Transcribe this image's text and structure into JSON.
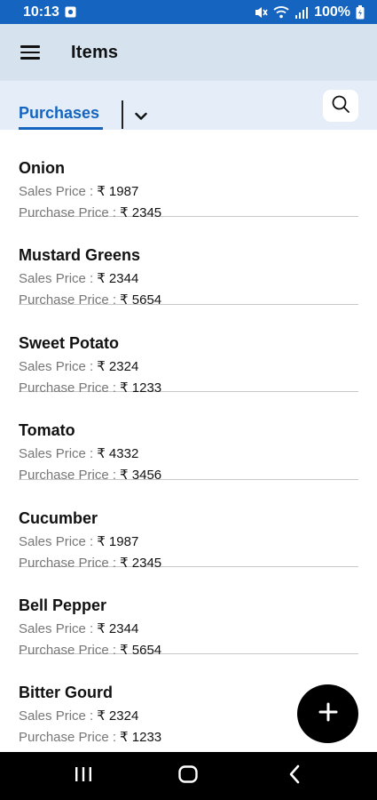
{
  "status_bar": {
    "time": "10:13",
    "battery": "100%"
  },
  "app_bar": {
    "title": "Items"
  },
  "tabs": {
    "active_label": "Purchases"
  },
  "labels": {
    "sales_price": "Sales Price :",
    "purchase_price": "Purchase Price :"
  },
  "items": [
    {
      "name": "Onion",
      "sales_price": "₹ 1987",
      "purchase_price": "₹ 2345"
    },
    {
      "name": "Mustard Greens",
      "sales_price": "₹ 2344",
      "purchase_price": "₹ 5654"
    },
    {
      "name": "Sweet Potato",
      "sales_price": "₹ 2324",
      "purchase_price": "₹ 1233"
    },
    {
      "name": "Tomato",
      "sales_price": "₹ 4332",
      "purchase_price": "₹ 3456"
    },
    {
      "name": "Cucumber",
      "sales_price": "₹ 1987",
      "purchase_price": "₹ 2345"
    },
    {
      "name": "Bell Pepper",
      "sales_price": "₹ 2344",
      "purchase_price": "₹ 5654"
    },
    {
      "name": "Bitter Gourd",
      "sales_price": "₹ 2324",
      "purchase_price": "₹ 1233"
    }
  ],
  "colors": {
    "status_bar": "#1565c0",
    "accent": "#1565c0",
    "app_bar": "#d6e3ef",
    "tab_row": "#e5eef8"
  },
  "icons": {
    "status": [
      "image-notification-icon",
      "mute-icon",
      "wifi-icon",
      "signal-icon",
      "battery-charging-icon"
    ],
    "app_bar": "menu-icon",
    "tab": "chevron-down-icon",
    "search": "search-icon",
    "fab": "plus-icon",
    "nav": [
      "recents-icon",
      "home-icon",
      "back-icon"
    ]
  }
}
